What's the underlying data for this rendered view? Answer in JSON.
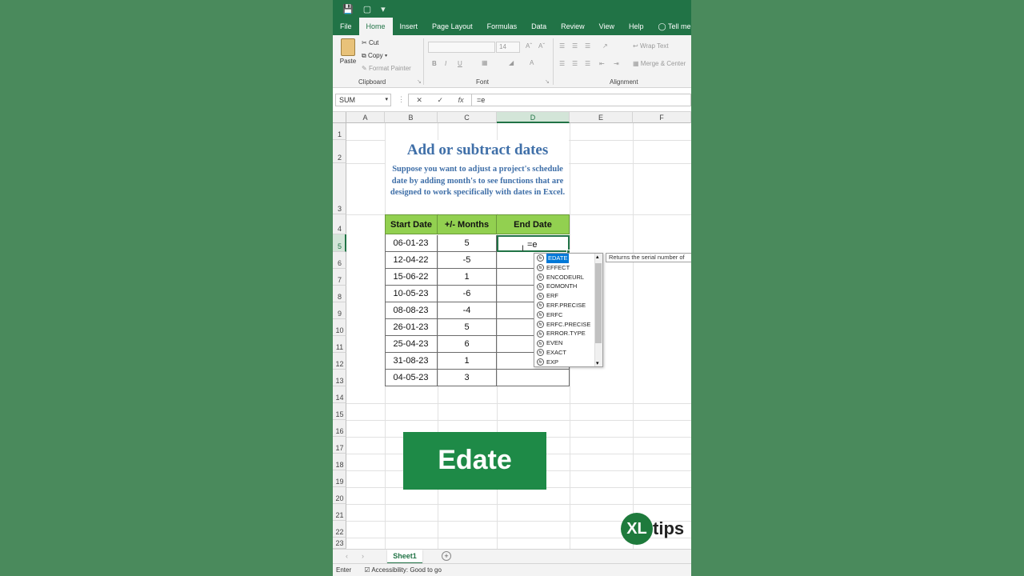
{
  "qat": {
    "icons": [
      "save-icon",
      "autosave-icon",
      "customize-icon"
    ]
  },
  "tabs": [
    "File",
    "Home",
    "Insert",
    "Page Layout",
    "Formulas",
    "Data",
    "Review",
    "View",
    "Help"
  ],
  "tell_me": "Tell me v",
  "ribbon": {
    "paste": "Paste",
    "cut": "Cut",
    "copy": "Copy",
    "format_painter": "Format Painter",
    "clipboard": "Clipboard",
    "font_size": "14",
    "font": "Font",
    "bold": "B",
    "italic": "I",
    "underline": "U",
    "wrap_text": "Wrap Text",
    "merge_center": "Merge & Center",
    "alignment": "Alignment"
  },
  "formula_bar": {
    "name_box": "SUM",
    "formula": "=e"
  },
  "columns": [
    "A",
    "B",
    "C",
    "D",
    "E",
    "F"
  ],
  "rows": [
    "1",
    "2",
    "3",
    "4",
    "5",
    "6",
    "7",
    "8",
    "9",
    "10",
    "11",
    "12",
    "13",
    "14",
    "15",
    "16",
    "17",
    "18",
    "19",
    "20",
    "21",
    "22",
    "23"
  ],
  "sheet": {
    "title": "Add or subtract dates",
    "description": "Suppose you want to adjust a project's schedule date by adding month's to see functions that are designed to work specifically with dates in Excel.",
    "headers": [
      "Start Date",
      "+/- Months",
      "End Date"
    ],
    "data": [
      [
        "06-01-23",
        "5"
      ],
      [
        "12-04-22",
        "-5"
      ],
      [
        "15-06-22",
        "1"
      ],
      [
        "10-05-23",
        "-6"
      ],
      [
        "08-08-23",
        "-4"
      ],
      [
        "26-01-23",
        "5"
      ],
      [
        "25-04-23",
        "6"
      ],
      [
        "31-08-23",
        "1"
      ],
      [
        "04-05-23",
        "3"
      ]
    ],
    "active_cell_value": "=e"
  },
  "autocomplete": {
    "items": [
      "EDATE",
      "EFFECT",
      "ENCODEURL",
      "EOMONTH",
      "ERF",
      "ERF.PRECISE",
      "ERFC",
      "ERFC.PRECISE",
      "ERROR.TYPE",
      "EVEN",
      "EXACT",
      "EXP"
    ],
    "tooltip": "Returns the serial number of"
  },
  "overlay": {
    "edate_label": "Edate",
    "logo_xl": "XL",
    "logo_tips": "tips"
  },
  "sheet_tab": "Sheet1",
  "status": {
    "mode": "Enter",
    "accessibility": "Accessibility: Good to go"
  }
}
